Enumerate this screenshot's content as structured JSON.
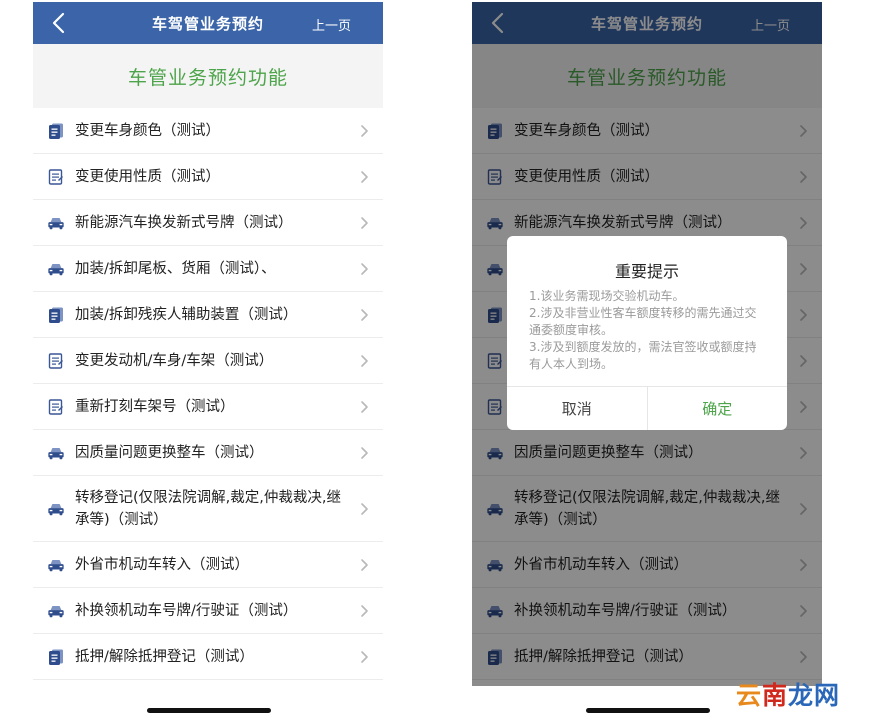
{
  "nav": {
    "title": "车驾管业务预约",
    "prev_label": "上一页"
  },
  "section_title": "车管业务预约功能",
  "items_left": [
    {
      "label": "变更车身颜色（测试）",
      "icon": "document-icon"
    },
    {
      "label": "变更使用性质（测试）",
      "icon": "form-icon"
    },
    {
      "label": "新能源汽车换发新式号牌（测试）",
      "icon": "car-icon"
    },
    {
      "label": "加装/拆卸尾板、货厢（测试）、",
      "icon": "car-icon"
    },
    {
      "label": "加装/拆卸残疾人辅助装置（测试）",
      "icon": "document-icon"
    },
    {
      "label": "变更发动机/车身/车架（测试）",
      "icon": "form-icon"
    },
    {
      "label": "重新打刻车架号（测试）",
      "icon": "form-icon"
    },
    {
      "label": "因质量问题更换整车（测试）",
      "icon": "car-icon"
    },
    {
      "label": "转移登记(仅限法院调解,裁定,仲裁裁决,继承等)（测试）",
      "icon": "car-icon"
    },
    {
      "label": "外省市机动车转入（测试）",
      "icon": "car-icon"
    },
    {
      "label": "补换领机动车号牌/行驶证（测试）",
      "icon": "car-icon"
    },
    {
      "label": "抵押/解除抵押登记（测试）",
      "icon": "document-icon"
    }
  ],
  "items_right": [
    {
      "label": "变更车身颜色（测试）",
      "icon": "document-icon"
    },
    {
      "label": "变更使用性质（测试）",
      "icon": "form-icon"
    },
    {
      "label": "新能源汽车换发新式号牌（测试）",
      "icon": "car-icon"
    },
    {
      "label": "",
      "icon": "car-icon"
    },
    {
      "label": "",
      "icon": "document-icon"
    },
    {
      "label": "",
      "icon": "form-icon"
    },
    {
      "label": "",
      "icon": "form-icon"
    },
    {
      "label": "因质量问题更换整车（测试）",
      "icon": "car-icon"
    },
    {
      "label": "转移登记(仅限法院调解,裁定,仲裁裁决,继承等)（测试）",
      "icon": "car-icon"
    },
    {
      "label": "外省市机动车转入（测试）",
      "icon": "car-icon"
    },
    {
      "label": "补换领机动车号牌/行驶证（测试）",
      "icon": "car-icon"
    },
    {
      "label": "抵押/解除抵押登记（测试）",
      "icon": "document-icon"
    }
  ],
  "dialog": {
    "title": "重要提示",
    "lines": [
      "1.该业务需现场交验机动车。",
      "2.涉及非营业性客车额度转移的需先通过交通委额度审核。",
      "3.涉及到额度发放的，需法官签收或额度持有人本人到场。"
    ],
    "cancel_label": "取消",
    "confirm_label": "确定"
  },
  "watermark": {
    "part1": "云",
    "part2": "南",
    "part3": "龙网"
  },
  "colors": {
    "navbar": "#3b65a8",
    "accent_green": "#4da44a",
    "icon_blue": "#2f4d8c"
  }
}
